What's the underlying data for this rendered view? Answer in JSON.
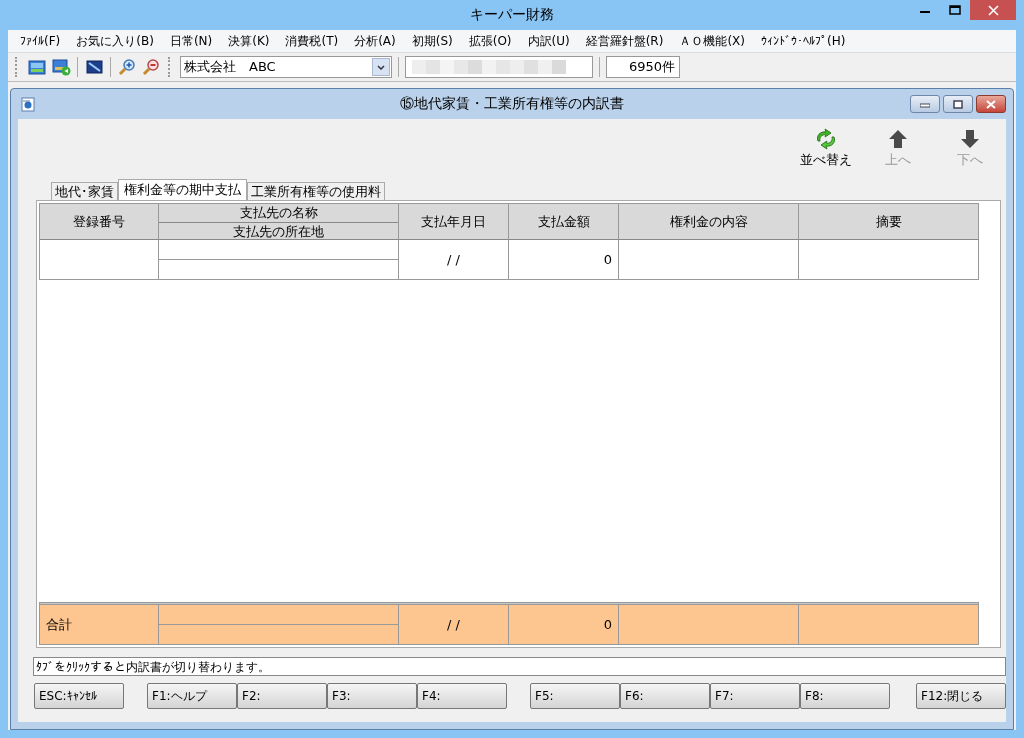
{
  "window": {
    "title": "キーパー財務"
  },
  "menu": [
    "ﾌｧｲﾙ(F)",
    "お気に入り(B)",
    "日常(N)",
    "決算(K)",
    "消費税(T)",
    "分析(A)",
    "初期(S)",
    "拡張(O)",
    "内訳(U)",
    "経営羅針盤(R)",
    "ＡＯ機能(X)",
    "ｳｨﾝﾄﾞｳ･ﾍﾙﾌﾟ(H)"
  ],
  "toolbar": {
    "company": "株式会社　ABC",
    "record_count": "6950件"
  },
  "document": {
    "title": "⑮地代家賃・工業所有権等の内訳書",
    "actions": [
      {
        "kind": "sort",
        "label": "並べ替え",
        "disabled": false
      },
      {
        "kind": "up",
        "label": "上へ",
        "disabled": true
      },
      {
        "kind": "down",
        "label": "下へ",
        "disabled": true
      }
    ],
    "tabs": [
      {
        "label": "地代･家賃",
        "selected": false
      },
      {
        "label": "権利金等の期中支払",
        "selected": true
      },
      {
        "label": "工業所有権等の使用料",
        "selected": false
      }
    ],
    "table": {
      "columns": [
        {
          "labels": [
            "登録番号"
          ]
        },
        {
          "labels": [
            "支払先の名称",
            "支払先の所在地"
          ]
        },
        {
          "labels": [
            "支払年月日"
          ]
        },
        {
          "labels": [
            "支払金額"
          ]
        },
        {
          "labels": [
            "権利金の内容"
          ]
        },
        {
          "labels": [
            "摘要"
          ]
        }
      ],
      "rows": [
        {
          "date": "/ /",
          "amount": "0"
        }
      ],
      "total": {
        "label": "合計",
        "date": "/ /",
        "amount": "0"
      }
    },
    "message": "ﾀﾌﾞをｸﾘｯｸすると内訳書が切り替わります。",
    "button_groups": [
      [
        "ESC:ｷｬﾝｾﾙ"
      ],
      [
        "F1:ヘルプ",
        "F2:",
        "F3:",
        "F4:"
      ],
      [
        "F5:",
        "F6:",
        "F7:",
        "F8:"
      ],
      [
        "F12:閉じる"
      ]
    ]
  }
}
